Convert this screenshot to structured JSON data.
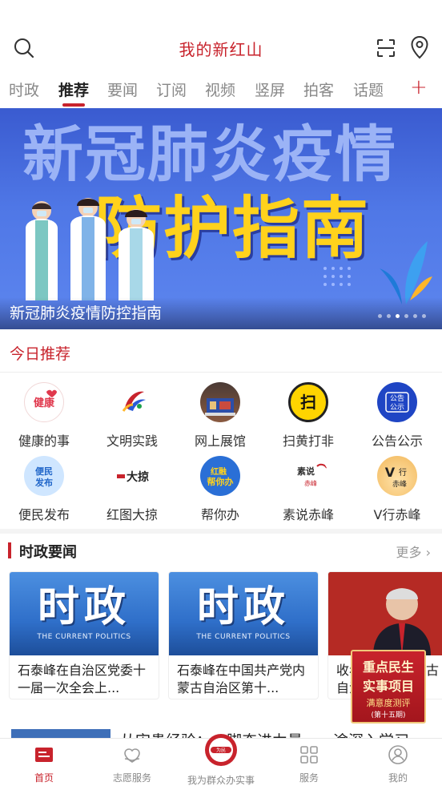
{
  "header": {
    "title": "我的新红山"
  },
  "tabs": [
    "时政",
    "推荐",
    "要闻",
    "订阅",
    "视频",
    "竖屏",
    "拍客",
    "话题"
  ],
  "active_tab": "推荐",
  "tab_add": "+",
  "banner": {
    "line1": "新冠肺炎疫情",
    "line2": "防护指南",
    "caption": "新冠肺炎疫情防控指南",
    "slide_count": 6,
    "active_slide": 3
  },
  "today": {
    "title": "今日推荐",
    "items": [
      {
        "label": "健康的事",
        "icon": "health-icon"
      },
      {
        "label": "文明实践",
        "icon": "civilization-icon"
      },
      {
        "label": "网上展馆",
        "icon": "exhibition-icon"
      },
      {
        "label": "扫黄打非",
        "icon": "anti-porn-icon"
      },
      {
        "label": "公告公示",
        "icon": "notice-icon"
      },
      {
        "label": "便民发布",
        "icon": "convenience-icon"
      },
      {
        "label": "红图大掠",
        "icon": "red-map-icon"
      },
      {
        "label": "帮你办",
        "icon": "help-you-icon"
      },
      {
        "label": "素说赤峰",
        "icon": "sushuo-icon"
      },
      {
        "label": "V行赤峰",
        "icon": "v-chifeng-icon"
      }
    ]
  },
  "section": {
    "title": "时政要闻",
    "more": "更多",
    "cards": [
      {
        "thumb_text": "时政",
        "thumb_en": "THE CURRENT POLITICS",
        "title": "石泰峰在自治区党委十一届一次全会上..."
      },
      {
        "thumb_text": "时政",
        "thumb_en": "THE CURRENT POLITICS",
        "title": "石泰峰在中国共产党内蒙古自治区第十..."
      },
      {
        "thumb_text": "",
        "thumb_en": "",
        "title": "收看共产党内蒙古自治区"
      }
    ]
  },
  "float_ad": {
    "line1": "重点民生",
    "line2": "实事项目",
    "line3": "满意度测评",
    "line4": "(第十五期)"
  },
  "peek_text": "从宋贵经验：一脚奋进力量，一途深入学习",
  "bottom_nav": [
    {
      "label": "首页",
      "icon": "home-icon"
    },
    {
      "label": "志愿服务",
      "icon": "volunteer-icon"
    },
    {
      "label": "我为群众办实事",
      "icon": "service-badge-icon"
    },
    {
      "label": "服务",
      "icon": "grid-icon"
    },
    {
      "label": "我的",
      "icon": "profile-icon"
    }
  ],
  "colors": {
    "accent": "#c8232c",
    "banner_blue": "#4f77e6",
    "banner_yellow": "#ffd21c"
  }
}
